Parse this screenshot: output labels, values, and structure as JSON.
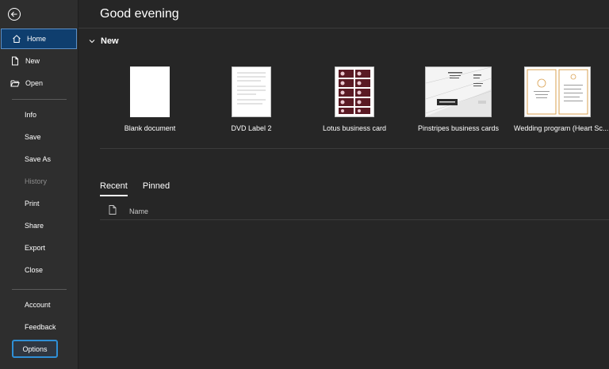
{
  "header": {
    "greeting": "Good evening"
  },
  "sidebar": {
    "home": "Home",
    "new": "New",
    "open": "Open",
    "info": "Info",
    "save": "Save",
    "save_as": "Save As",
    "history": "History",
    "print": "Print",
    "share": "Share",
    "export": "Export",
    "close": "Close",
    "account": "Account",
    "feedback": "Feedback",
    "options": "Options"
  },
  "new_section": {
    "label": "New",
    "templates": [
      {
        "name": "Blank document"
      },
      {
        "name": "DVD Label 2"
      },
      {
        "name": "Lotus business card"
      },
      {
        "name": "Pinstripes business cards"
      },
      {
        "name": "Wedding program (Heart Sc..."
      }
    ]
  },
  "recent": {
    "tabs": [
      "Recent",
      "Pinned"
    ],
    "columns": {
      "name": "Name"
    }
  },
  "colors": {
    "accent": "#2f8fd6",
    "selected_bg": "#0f3e6e",
    "background": "#262626",
    "sidebar": "#2e2e2e"
  }
}
